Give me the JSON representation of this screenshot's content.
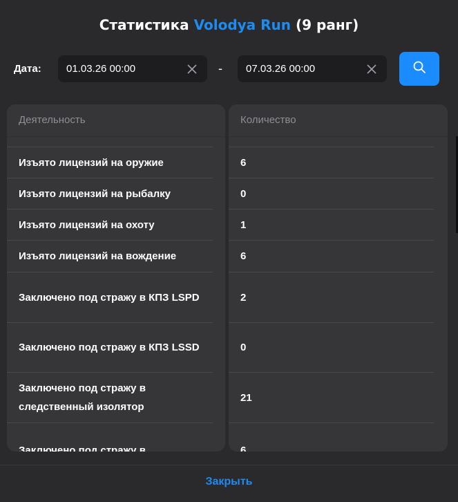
{
  "header": {
    "title_prefix": "Статистика",
    "player_name": "Volodya Run",
    "title_suffix": "(9 ранг)",
    "accent_color": "#1e8bf0"
  },
  "filters": {
    "date_label": "Дата:",
    "date_from": "01.03.26 00:00",
    "date_to": "07.03.26 00:00",
    "separator": "-",
    "clear_icon": "close-icon",
    "search_icon": "search-icon",
    "search_button_color": "#1a8cff"
  },
  "table": {
    "columns": [
      "Деятельность",
      "Количество"
    ],
    "rows": [
      {
        "activity": "Изъято лицензий на оружие",
        "count": "6"
      },
      {
        "activity": "Изъято лицензий на рыбалку",
        "count": "0"
      },
      {
        "activity": "Изъято лицензий на охоту",
        "count": "1"
      },
      {
        "activity": "Изъято лицензий на вождение",
        "count": "6"
      },
      {
        "activity": "Заключено под стражу в КПЗ LSPD",
        "count": "2"
      },
      {
        "activity": "Заключено под стражу в КПЗ LSSD",
        "count": "0"
      },
      {
        "activity": "Заключено под стражу в следственный изолятор",
        "count": "21"
      },
      {
        "activity": "Заключено под стражу в",
        "count": "6"
      }
    ]
  },
  "footer": {
    "close_label": "Закрыть"
  }
}
